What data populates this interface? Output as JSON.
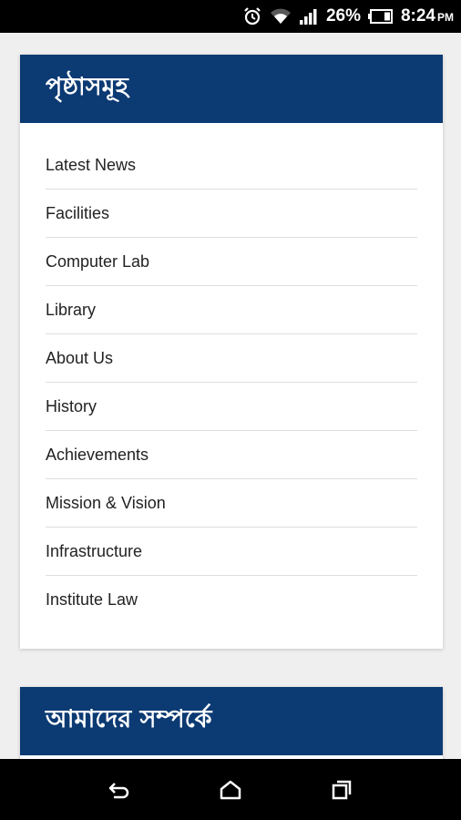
{
  "status_bar": {
    "battery_percent": "26%",
    "time": "8:24",
    "ampm": "PM",
    "icons": [
      "alarm-icon",
      "wifi-icon",
      "signal-icon",
      "battery-icon"
    ]
  },
  "pages_card": {
    "title": "পৃষ্ঠাসমূহ",
    "items": [
      {
        "label": "Latest News"
      },
      {
        "label": "Facilities"
      },
      {
        "label": "Computer Lab"
      },
      {
        "label": "Library"
      },
      {
        "label": "About Us"
      },
      {
        "label": "History"
      },
      {
        "label": "Achievements"
      },
      {
        "label": "Mission & Vision"
      },
      {
        "label": "Infrastructure"
      },
      {
        "label": "Institute Law"
      }
    ]
  },
  "about_card": {
    "title": "আমাদের সম্পর্কে"
  },
  "nav_bar": {
    "buttons": [
      "back-icon",
      "home-icon",
      "recents-icon"
    ]
  },
  "colors": {
    "header_bg": "#0c3a73",
    "page_bg": "#efefef"
  }
}
